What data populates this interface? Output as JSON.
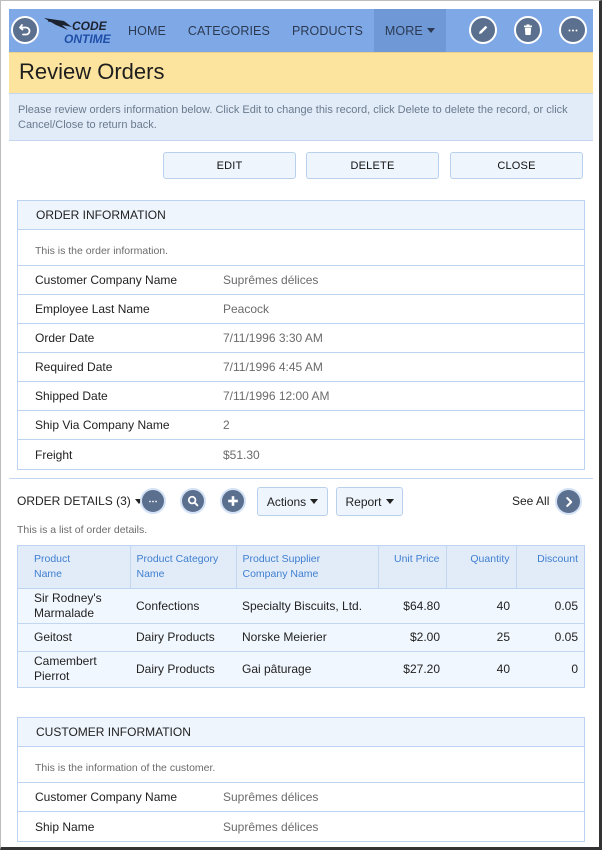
{
  "topbar": {
    "back_icon": "back-arrow-icon",
    "logo_line1": "CODE",
    "logo_line2": "ONTIME",
    "nav": [
      {
        "label": "HOME"
      },
      {
        "label": "CATEGORIES"
      },
      {
        "label": "PRODUCTS"
      },
      {
        "label": "MORE",
        "active": true,
        "has_dropdown": true
      }
    ],
    "icons": [
      "pencil-icon",
      "trash-icon",
      "more-dots-icon"
    ]
  },
  "page": {
    "title": "Review Orders",
    "description": "Please review orders information below. Click Edit to change this record, click Delete to delete the record, or click Cancel/Close to return back."
  },
  "actions": {
    "edit": "EDIT",
    "delete": "DELETE",
    "close": "CLOSE"
  },
  "order_info": {
    "title": "ORDER INFORMATION",
    "description": "This is the order information.",
    "fields": [
      {
        "label": "Customer Company Name",
        "value": "Suprêmes délices"
      },
      {
        "label": "Employee Last Name",
        "value": "Peacock"
      },
      {
        "label": "Order Date",
        "value": "7/11/1996 3:30 AM"
      },
      {
        "label": "Required Date",
        "value": "7/11/1996 4:45 AM"
      },
      {
        "label": "Shipped Date",
        "value": "7/11/1996 12:00 AM"
      },
      {
        "label": "Ship Via Company Name",
        "value": "2"
      },
      {
        "label": "Freight",
        "value": "$51.30"
      }
    ]
  },
  "order_details": {
    "title": "ORDER DETAILS (3)",
    "actions_label": "Actions",
    "report_label": "Report",
    "see_all_label": "See All",
    "description": "This is a list of order details.",
    "columns": [
      {
        "line1": "Product",
        "line2": "Name"
      },
      {
        "line1": "Product Category",
        "line2": "Name"
      },
      {
        "line1": "Product Supplier",
        "line2": "Company Name"
      },
      {
        "line1": "Unit Price",
        "line2": ""
      },
      {
        "line1": "Quantity",
        "line2": ""
      },
      {
        "line1": "Discount",
        "line2": ""
      }
    ],
    "rows": [
      {
        "product_l1": "Sir Rodney's",
        "product_l2": "Marmalade",
        "category": "Confections",
        "supplier": "Specialty Biscuits, Ltd.",
        "unit_price": "$64.80",
        "quantity": "40",
        "discount": "0.05"
      },
      {
        "product_l1": "Geitost",
        "product_l2": "",
        "category": "Dairy Products",
        "supplier": "Norske Meierier",
        "unit_price": "$2.00",
        "quantity": "25",
        "discount": "0.05"
      },
      {
        "product_l1": "Camembert",
        "product_l2": "Pierrot",
        "category": "Dairy Products",
        "supplier": "Gai pâturage",
        "unit_price": "$27.20",
        "quantity": "40",
        "discount": "0"
      }
    ]
  },
  "customer_info": {
    "title": "CUSTOMER INFORMATION",
    "description": "This is the information of the customer.",
    "fields": [
      {
        "label": "Customer Company Name",
        "value": "Suprêmes délices"
      },
      {
        "label": "Ship Name",
        "value": "Suprêmes délices"
      }
    ]
  },
  "colors": {
    "topbar": "#7fa8e6",
    "title_band": "#fde49e",
    "desc_band": "#e2ecf9",
    "icon_fill": "#5b6f8f",
    "grid_header_text": "#3f7fd0"
  }
}
